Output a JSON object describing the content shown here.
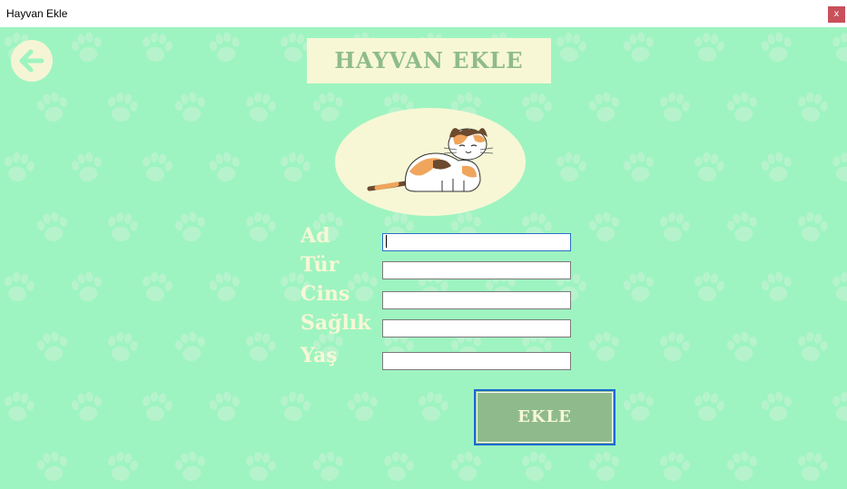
{
  "window": {
    "title": "Hayvan Ekle",
    "close_label": "x"
  },
  "header": {
    "title": "HAYVAN EKLE"
  },
  "form": {
    "fields": [
      {
        "label": "Ad",
        "value": ""
      },
      {
        "label": "Tür",
        "value": ""
      },
      {
        "label": "Cins",
        "value": ""
      },
      {
        "label": "Sağlık",
        "value": ""
      },
      {
        "label": "Yaş",
        "value": ""
      }
    ],
    "submit_label": "EKLE"
  },
  "icons": {
    "back": "arrow-left-icon",
    "illustration": "cat-illustration",
    "background": "paw-print-pattern"
  },
  "colors": {
    "background": "#9ef4c0",
    "panel": "#f7f7d6",
    "accent": "#8fbb8c",
    "focus_border": "#1b6ad2",
    "close_button": "#c8505a"
  }
}
